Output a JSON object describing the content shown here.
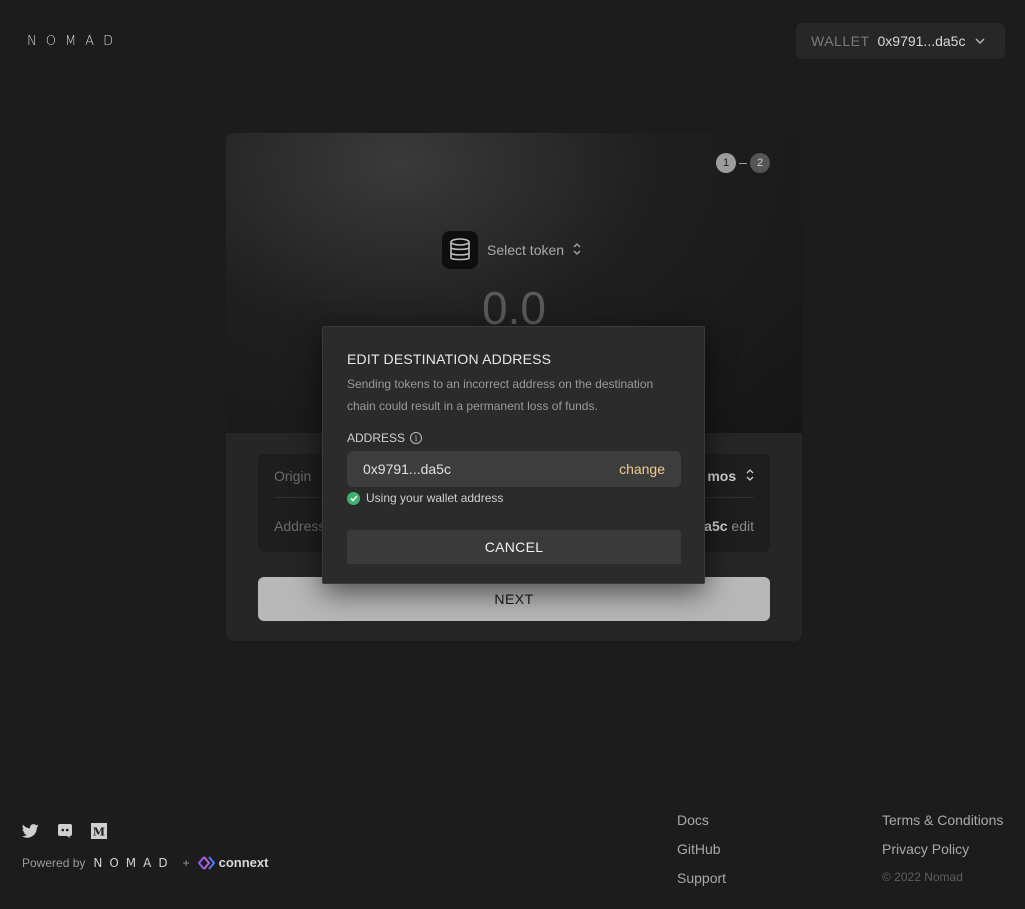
{
  "header": {
    "logo_text": "NOMAD",
    "wallet_label": "WALLET",
    "wallet_address": "0x9791...da5c",
    "wallet_icon": "chevron-down-icon"
  },
  "bridge": {
    "steps": [
      "1",
      "2"
    ],
    "active_step": 1,
    "token_select_label": "Select token",
    "token_icon": "database-icon",
    "amount": "0.0",
    "origin_label": "Origin",
    "origin_value": "mos",
    "address_label": "Address",
    "address_value": "a5c",
    "address_edit": "edit",
    "next_label": "NEXT"
  },
  "modal": {
    "title": "EDIT DESTINATION ADDRESS",
    "description": "Sending tokens to an incorrect address on the destination chain could result in a permanent loss of funds.",
    "address_label": "ADDRESS",
    "address_value": "0x9791...da5c",
    "change_label": "change",
    "status_text": "Using your wallet address",
    "cancel_label": "CANCEL"
  },
  "footer": {
    "social_icons": [
      "twitter-icon",
      "discord-icon",
      "medium-icon"
    ],
    "powered_by": "Powered by",
    "nomad": "NOMAD",
    "plus": "+",
    "connext": "connext",
    "links_col1": [
      "Docs",
      "GitHub",
      "Support"
    ],
    "links_col2": [
      "Terms & Conditions",
      "Privacy Policy"
    ],
    "copyright": "© 2022 Nomad"
  },
  "colors": {
    "background": "#1c1c1c",
    "accent_change": "#f2c98b",
    "success": "#3cb46e"
  }
}
